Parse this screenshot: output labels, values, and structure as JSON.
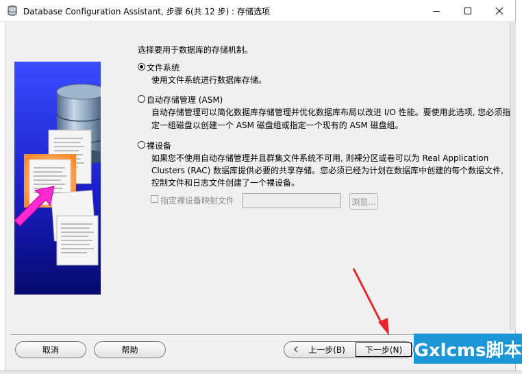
{
  "window": {
    "title": "Database Configuration Assistant, 步骤 6(共 12 步) : 存储选项"
  },
  "content": {
    "intro": "选择要用于数据库的存储机制。",
    "options": [
      {
        "label": "文件系统",
        "checked": true,
        "description": [
          "使用文件系统进行数据库存储。"
        ]
      },
      {
        "label": "自动存储管理 (ASM)",
        "checked": false,
        "description": [
          "自动存储管理可以简化数据库存储管理并优化数据库布局以改进 I/O 性能。要使用此选项, 您必须指",
          "定一组磁盘以创建一个 ASM 磁盘组或指定一个现有的 ASM 磁盘组。"
        ]
      },
      {
        "label": "裸设备",
        "checked": false,
        "description": [
          "如果您不使用自动存储管理并且群集文件系统不可用, 则裸分区或卷可以为 Real Application",
          "Clusters (RAC) 数据库提供必要的共享存储。您必须已经为计划在数据库中创建的每个数据文件,",
          "控制文件和日志文件创建了一个裸设备。"
        ]
      }
    ],
    "raw_mapping": {
      "checkbox_label": "指定裸设备映射文件",
      "path_value": "",
      "browse_label": "浏览..."
    }
  },
  "footer": {
    "cancel_label": "取消",
    "help_label": "帮助",
    "back_label": "上一步(B)",
    "next_label": "下一步(N)"
  },
  "watermark": "Gxlcms脚本"
}
